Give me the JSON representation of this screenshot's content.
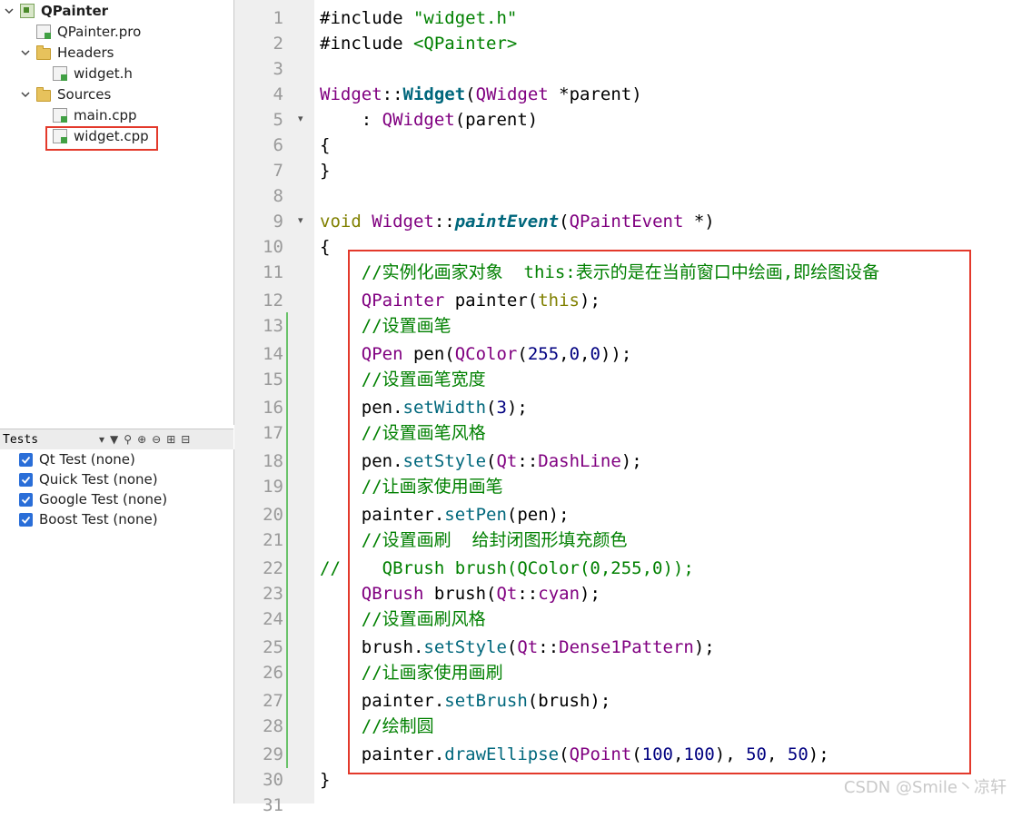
{
  "project_tree": {
    "project": "QPainter",
    "pro_file": "QPainter.pro",
    "headers_folder": "Headers",
    "header_file": "widget.h",
    "sources_folder": "Sources",
    "source_main": "main.cpp",
    "source_widget": "widget.cpp"
  },
  "tests": {
    "title": "Tests",
    "items": [
      {
        "label": "Qt Test (none)",
        "checked": true
      },
      {
        "label": "Quick Test (none)",
        "checked": true
      },
      {
        "label": "Google Test (none)",
        "checked": true
      },
      {
        "label": "Boost Test (none)",
        "checked": true
      }
    ]
  },
  "editor": {
    "line_numbers": [
      "1",
      "2",
      "3",
      "4",
      "5",
      "6",
      "7",
      "8",
      "9",
      "10",
      "11",
      "12",
      "13",
      "14",
      "15",
      "16",
      "17",
      "18",
      "19",
      "20",
      "21",
      "22",
      "23",
      "24",
      "25",
      "26",
      "27",
      "28",
      "29",
      "30",
      "31"
    ],
    "lines": {
      "l1_inc": "#include ",
      "l1_str": "\"widget.h\"",
      "l2_inc": "#include ",
      "l2_str": "<QPainter>",
      "l4_a": "Widget",
      "l4_b": "::",
      "l4_c": "Widget",
      "l4_d": "(",
      "l4_e": "QWidget",
      "l4_f": " *parent)",
      "l5_a": "    : ",
      "l5_b": "QWidget",
      "l5_c": "(parent)",
      "l6": "{",
      "l7": "}",
      "l9_a": "void",
      "l9_b": " Widget",
      "l9_c": "::",
      "l9_d": "paintEvent",
      "l9_e": "(",
      "l9_f": "QPaintEvent",
      "l9_g": " *)",
      "l10": "{",
      "l11": "    //实例化画家对象  this:表示的是在当前窗口中绘画,即绘图设备",
      "l12_a": "    QPainter",
      "l12_b": " painter(",
      "l12_c": "this",
      "l12_d": ");",
      "l13": "    //设置画笔",
      "l14_a": "    QPen",
      "l14_b": " pen(",
      "l14_c": "QColor",
      "l14_d": "(",
      "l14_e": "255",
      "l14_f": ",",
      "l14_g": "0",
      "l14_h": ",",
      "l14_i": "0",
      "l14_j": "));",
      "l15": "    //设置画笔宽度",
      "l16_a": "    pen.",
      "l16_b": "setWidth",
      "l16_c": "(",
      "l16_d": "3",
      "l16_e": ");",
      "l17": "    //设置画笔风格",
      "l18_a": "    pen.",
      "l18_b": "setStyle",
      "l18_c": "(",
      "l18_d": "Qt",
      "l18_e": "::",
      "l18_f": "DashLine",
      "l18_g": ");",
      "l19": "    //让画家使用画笔",
      "l20_a": "    painter.",
      "l20_b": "setPen",
      "l20_c": "(pen);",
      "l21": "    //设置画刷  给封闭图形填充颜色",
      "l22": "//    QBrush brush(QColor(0,255,0));",
      "l23_a": "    QBrush",
      "l23_b": " brush(",
      "l23_c": "Qt",
      "l23_d": "::",
      "l23_e": "cyan",
      "l23_f": ");",
      "l24": "    //设置画刷风格",
      "l25_a": "    brush.",
      "l25_b": "setStyle",
      "l25_c": "(",
      "l25_d": "Qt",
      "l25_e": "::",
      "l25_f": "Dense1Pattern",
      "l25_g": ");",
      "l26": "    //让画家使用画刷",
      "l27_a": "    painter.",
      "l27_b": "setBrush",
      "l27_c": "(brush);",
      "l28": "    //绘制圆",
      "l29_a": "    painter.",
      "l29_b": "drawEllipse",
      "l29_c": "(",
      "l29_d": "QPoint",
      "l29_e": "(",
      "l29_f": "100",
      "l29_g": ",",
      "l29_h": "100",
      "l29_i": "), ",
      "l29_j": "50",
      "l29_k": ", ",
      "l29_l": "50",
      "l29_m": ");",
      "l30": "}"
    }
  },
  "watermark": "CSDN @Smile丶凉轩",
  "colors": {
    "highlight_box": "#e3392b",
    "checkbox": "#2a6ed8",
    "comment": "#008000",
    "type": "#800080",
    "keyword": "#808000",
    "function": "#00677c"
  }
}
